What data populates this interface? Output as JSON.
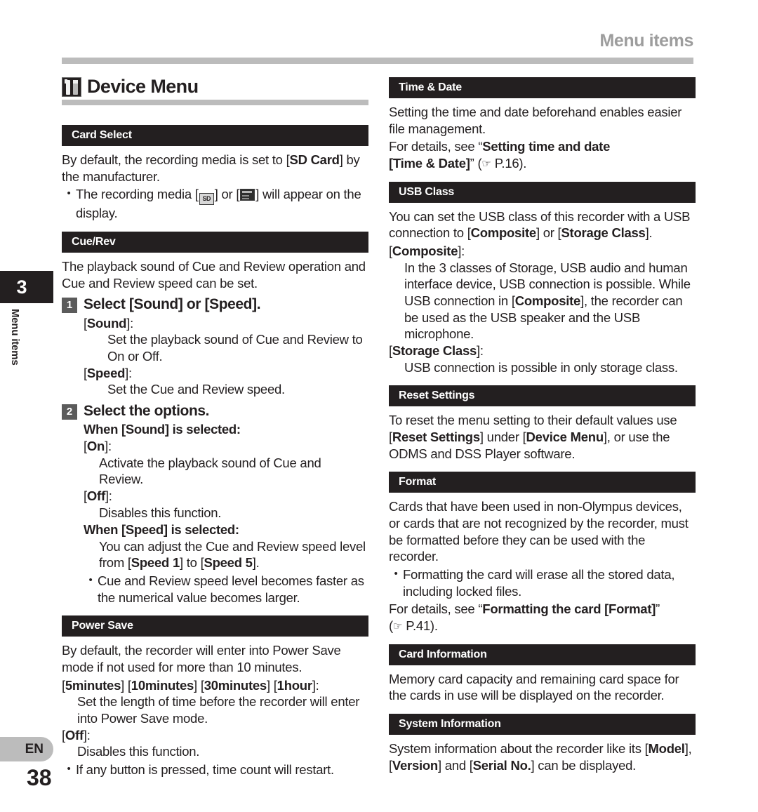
{
  "header": {
    "running_title": "Menu items"
  },
  "sidebar": {
    "chapter_number": "3",
    "chapter_label": "Menu items"
  },
  "footer": {
    "language": "EN",
    "page_number": "38"
  },
  "menu_title": {
    "icon": "tools-icon",
    "text": "Device Menu"
  },
  "left_column": {
    "card_select": {
      "heading": "Card Select",
      "body": "By default, the recording media is set to [SD Card] by the manufacturer.",
      "bullet": "The recording media [SD] or [MEM] will appear on the display.",
      "bullet_pre": "The recording media ",
      "bullet_mid": " or ",
      "bullet_post": " will appear on the display.",
      "icon_sd_label": "SD",
      "icon_sd_name": "sd-card-icon",
      "icon_mem_name": "internal-memory-icon"
    },
    "cue_rev": {
      "heading": "Cue/Rev",
      "body": "The playback sound of Cue and Review operation and Cue and Review speed can be set.",
      "step1": {
        "number": "1",
        "title": "Select [Sound] or [Speed].",
        "sound_label": "[Sound]:",
        "sound_desc": "Set the playback sound of Cue and Review to On or Off.",
        "speed_label": "[Speed]:",
        "speed_desc": "Set the Cue and Review speed."
      },
      "step2": {
        "number": "2",
        "title": "Select the options.",
        "when_sound": "When [Sound] is selected:",
        "on_label": "[On]:",
        "on_desc": "Activate the playback sound of Cue and Review.",
        "off_label": "[Off]:",
        "off_desc": "Disables this function.",
        "when_speed": "When [Speed] is selected:",
        "speed_desc": "You can adjust the Cue and Review speed level from [Speed 1] to [Speed 5].",
        "bullet": "Cue and Review speed level becomes faster as the numerical value becomes larger."
      }
    },
    "power_save": {
      "heading": "Power Save",
      "body": "By default, the recorder will enter into Power Save mode if not used for more than 10 minutes.",
      "options_line": "[5minutes] [10minutes] [30minutes] [1hour]:",
      "options_desc": "Set the length of time before the recorder will enter into Power Save mode.",
      "off_label": "[Off]:",
      "off_desc": "Disables this function.",
      "bullet": "If any button is pressed, time count will restart."
    }
  },
  "right_column": {
    "time_date": {
      "heading": "Time & Date",
      "body": "Setting the time and date beforehand enables easier file management.",
      "detail_pre": "For details, see “",
      "detail_bold": "Setting time and date [Time & Date]",
      "detail_post": "” (",
      "detail_ref": " P.16).",
      "ref_icon": "pointing-hand-icon"
    },
    "usb_class": {
      "heading": "USB Class",
      "body": "You can set the USB class of this recorder with a USB connection to [Composite] or [Storage Class].",
      "composite_label": "[Composite]:",
      "composite_desc": "In the 3 classes of Storage, USB audio and human interface device, USB connection is possible. While USB connection in [Composite], the recorder can be used as the USB speaker and the USB microphone.",
      "storage_label": "[Storage Class]:",
      "storage_desc": "USB connection is possible in only storage class."
    },
    "reset_settings": {
      "heading": "Reset Settings",
      "body": "To reset the menu setting to their default values use [Reset Settings] under [Device Menu], or use the ODMS and DSS Player software."
    },
    "format": {
      "heading": "Format",
      "body": "Cards that have been used in non-Olympus devices, or cards that are not recognized by the recorder, must be formatted before they can be used with the recorder.",
      "bullet": "Formatting the card will erase all the stored data, including locked files.",
      "detail_pre": "For details, see “",
      "detail_bold": "Formatting the card [Format]",
      "detail_post": "”",
      "detail_ref": " P.41).",
      "ref_icon": "pointing-hand-icon"
    },
    "card_information": {
      "heading": "Card Information",
      "body": "Memory card capacity and remaining card space for the cards in use will be displayed on the recorder."
    },
    "system_information": {
      "heading": "System Information",
      "body": "System information about the recorder like its [Model], [Version] and [Serial No.] can be displayed."
    }
  }
}
